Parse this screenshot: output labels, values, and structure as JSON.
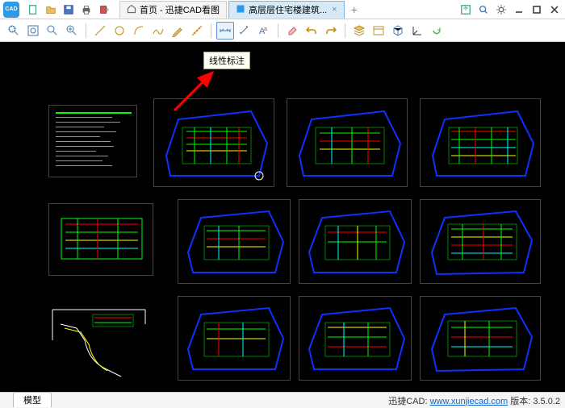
{
  "title_icons": [
    "new",
    "open",
    "save",
    "print",
    "recent"
  ],
  "tabs": [
    {
      "label": "首页 - 迅捷CAD看图",
      "active": false,
      "home": true
    },
    {
      "label": "高层层住宅楼建筑...",
      "active": true,
      "home": false
    }
  ],
  "tooltip": "线性标注",
  "bottom_tab": "模型",
  "status": {
    "brand": "迅捷CAD:",
    "url": "www.xunjiecad.com",
    "version_label": "版本:",
    "version": "3.5.0.2"
  },
  "window_controls": [
    "export",
    "reset-zoom",
    "settings",
    "minimize",
    "maximize",
    "close"
  ]
}
